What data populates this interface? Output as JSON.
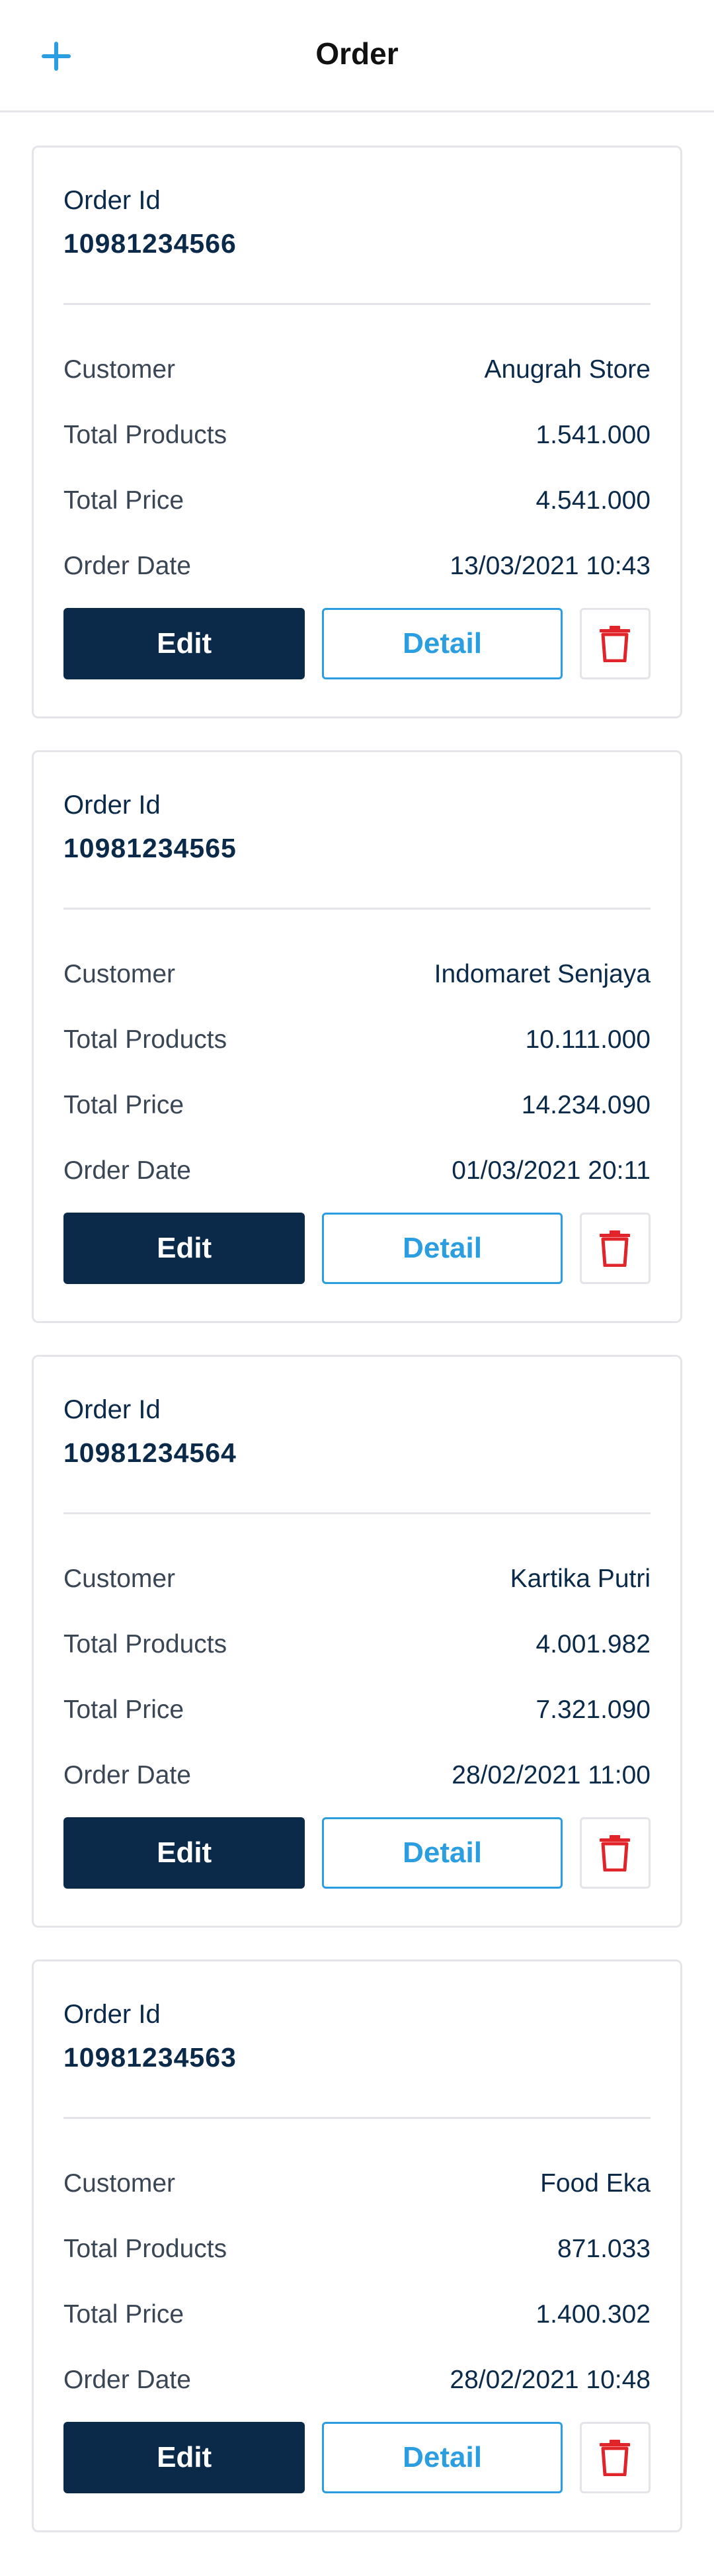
{
  "header": {
    "title": "Order",
    "add_icon": "plus-icon",
    "accent_color": "#2a9ee0"
  },
  "colors": {
    "primary": "#0b2a4a",
    "accent": "#2a9ee0",
    "danger": "#e0242a",
    "border": "#e3e5e8"
  },
  "card_labels": {
    "order_id": "Order Id",
    "customer": "Customer",
    "total_products": "Total Products",
    "total_price": "Total Price",
    "order_date": "Order Date",
    "edit": "Edit",
    "detail": "Detail",
    "delete_icon": "trash-icon"
  },
  "orders": [
    {
      "id": "10981234566",
      "customer": "Anugrah Store",
      "total_products": "1.541.000",
      "total_price": "4.541.000",
      "order_date": "13/03/2021 10:43"
    },
    {
      "id": "10981234565",
      "customer": "Indomaret Senjaya",
      "total_products": "10.111.000",
      "total_price": "14.234.090",
      "order_date": "01/03/2021 20:11"
    },
    {
      "id": "10981234564",
      "customer": "Kartika Putri",
      "total_products": "4.001.982",
      "total_price": "7.321.090",
      "order_date": "28/02/2021 11:00"
    },
    {
      "id": "10981234563",
      "customer": "Food Eka",
      "total_products": "871.033",
      "total_price": "1.400.302",
      "order_date": "28/02/2021 10:48"
    }
  ]
}
